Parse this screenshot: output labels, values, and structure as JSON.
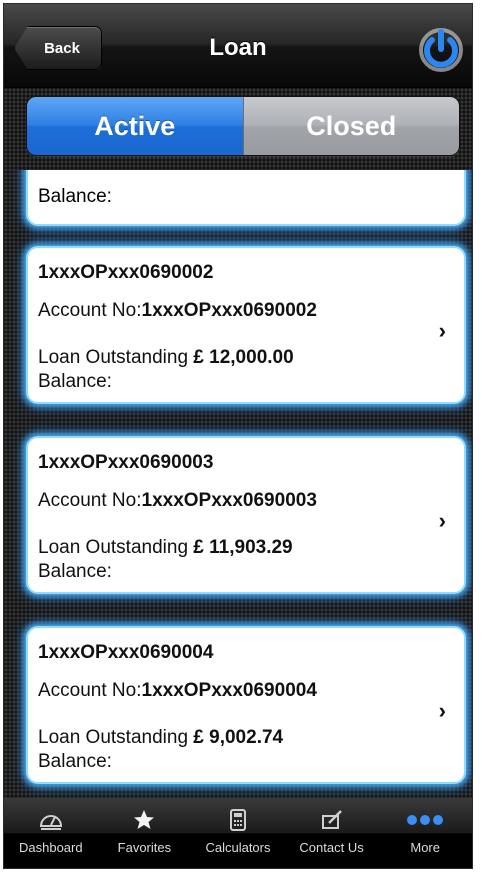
{
  "navbar": {
    "back_label": "Back",
    "title": "Loan",
    "power_icon": "power-icon"
  },
  "segment": {
    "active_label": "Active",
    "closed_label": "Closed"
  },
  "loans_partial": {
    "balance_label": "Balance:"
  },
  "loans": [
    {
      "title": "1xxxOPxxx0690002",
      "account_label": "Account No:",
      "account_no": "1xxxOPxxx0690002",
      "outstanding_label": "Loan Outstanding",
      "amount": "£ 12,000.00",
      "balance_label": "Balance:"
    },
    {
      "title": "1xxxOPxxx0690003",
      "account_label": "Account No:",
      "account_no": "1xxxOPxxx0690003",
      "outstanding_label": "Loan Outstanding",
      "amount": "£ 11,903.29",
      "balance_label": "Balance:"
    },
    {
      "title": "1xxxOPxxx0690004",
      "account_label": "Account No:",
      "account_no": "1xxxOPxxx0690004",
      "outstanding_label": "Loan Outstanding",
      "amount": "£ 9,002.74",
      "balance_label": "Balance:"
    }
  ],
  "tabbar": {
    "items": [
      {
        "label": "Dashboard",
        "icon": "gauge-icon"
      },
      {
        "label": "Favorites",
        "icon": "star-icon"
      },
      {
        "label": "Calculators",
        "icon": "calculator-icon"
      },
      {
        "label": "Contact Us",
        "icon": "pencil-note-icon"
      },
      {
        "label": "More",
        "icon": "more-dots-icon"
      }
    ]
  },
  "colors": {
    "active_segment": "#2f7fe3",
    "card_glow": "#50b4ff",
    "power_icon": "#2a86f0"
  }
}
